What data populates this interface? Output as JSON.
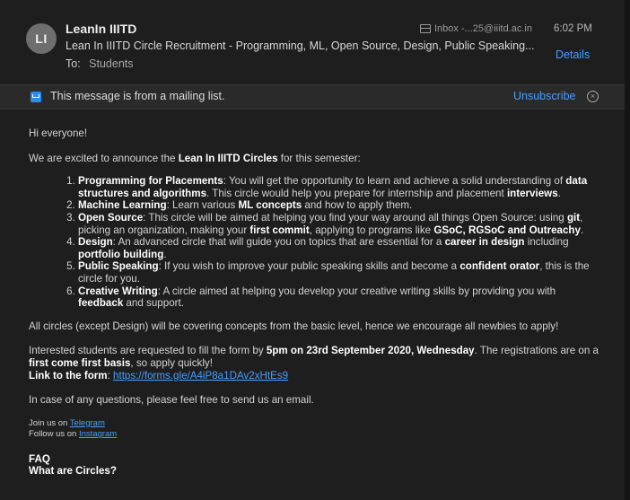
{
  "header": {
    "avatar_initials": "LI",
    "sender": "LeanIn IIITD",
    "subject": "Lean In IIITD Circle Recruitment - Programming, ML, Open Source, Design, Public Speaking...",
    "to_label": "To:",
    "to_value": "Students",
    "mailbox": "Inbox -...25@iiitd.ac.in",
    "time": "6:02 PM",
    "details_label": "Details"
  },
  "banner": {
    "text": "This message is from a mailing list.",
    "unsubscribe_label": "Unsubscribe"
  },
  "body": {
    "greeting": "Hi everyone!",
    "intro_pre": "We are excited to announce the ",
    "intro_bold": "Lean In IIITD Circles",
    "intro_post": " for this semester:",
    "items": [
      {
        "t1b": "Programming for Placements",
        "t2": ": You will get the opportunity to learn and achieve a solid understanding of ",
        "t3b": "data structures and algorithms",
        "t4": ". This circle would help you prepare for internship and placement ",
        "t5b": "interviews",
        "t6": "."
      },
      {
        "t1b": "Machine Learning",
        "t2": ": Learn various ",
        "t3b": "ML concepts",
        "t4": " and how to apply them.",
        "t5b": "",
        "t6": ""
      },
      {
        "t1b": "Open Source",
        "t2": ": This circle will be aimed at helping you find your way around all things Open Source: using ",
        "t3b": "git",
        "t4": ", picking an organization, making your ",
        "t5b": "first commit",
        "t6": ", applying to programs like ",
        "t7b": "GSoC, RGSoC and Outreachy",
        "t8": "."
      },
      {
        "t1b": "Design",
        "t2": ": An advanced circle that will guide you on topics that are essential for a ",
        "t3b": "career in design",
        "t4": " including ",
        "t5b": "portfolio building",
        "t6": "."
      },
      {
        "t1b": "Public Speaking",
        "t2": ": If you wish to improve your public speaking skills and become a ",
        "t3b": "confident orator",
        "t4": ", this is the circle for you.",
        "t5b": "",
        "t6": ""
      },
      {
        "t1b": "Creative Writing",
        "t2": ": A circle aimed at helping you develop your creative writing skills by providing you with ",
        "t3b": "feedback",
        "t4": " and support.",
        "t5b": "",
        "t6": ""
      }
    ],
    "all_circles": "All circles (except Design) will be covering concepts from the basic level, hence we encourage all newbies to apply!",
    "interest_pre": "Interested students are requested to fill the form by ",
    "interest_bold": "5pm on 23rd September 2020, Wednesday",
    "interest_mid": ". The registrations are on a ",
    "interest_bold2": "first come first basis",
    "interest_post": ", so apply quickly!",
    "link_label": "Link to the form",
    "link_sep": ": ",
    "link_url": "https://forms.gle/A4iP8a1DAv2xHtEs9",
    "questions": "In case of any questions, please feel free to send us an email.",
    "join_pre": "Join us on ",
    "join_link": "Telegram",
    "follow_pre": "Follow us on ",
    "follow_link": "Instagram",
    "faq": "FAQ",
    "faq_q1": "What are Circles?"
  }
}
